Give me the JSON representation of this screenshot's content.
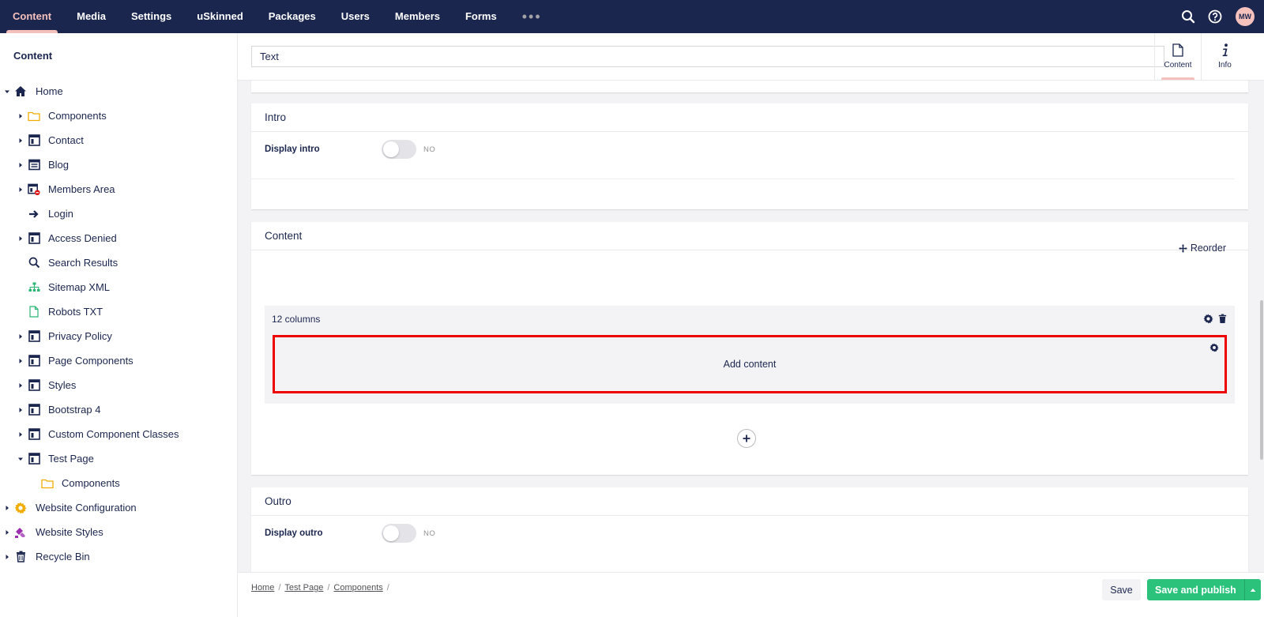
{
  "nav": {
    "sections": [
      "Content",
      "Media",
      "Settings",
      "uSkinned",
      "Packages",
      "Users",
      "Members",
      "Forms"
    ],
    "more": "•••",
    "avatar_initials": "MW",
    "icons": [
      "search-icon",
      "help-icon"
    ]
  },
  "sidebar": {
    "title": "Content",
    "tree": [
      {
        "label": "Home",
        "icon": "home-icon"
      },
      {
        "label": "Components",
        "icon": "folder-icon"
      },
      {
        "label": "Contact",
        "icon": "page-icon"
      },
      {
        "label": "Blog",
        "icon": "blog-icon"
      },
      {
        "label": "Members Area",
        "icon": "protected-page-icon"
      },
      {
        "label": "Login",
        "icon": "arrow-right-icon"
      },
      {
        "label": "Access Denied",
        "icon": "page-icon"
      },
      {
        "label": "Search Results",
        "icon": "search-icon"
      },
      {
        "label": "Sitemap XML",
        "icon": "sitemap-icon"
      },
      {
        "label": "Robots TXT",
        "icon": "document-icon"
      },
      {
        "label": "Privacy Policy",
        "icon": "page-icon"
      },
      {
        "label": "Page Components",
        "icon": "page-icon"
      },
      {
        "label": "Styles",
        "icon": "page-icon"
      },
      {
        "label": "Bootstrap 4",
        "icon": "page-icon"
      },
      {
        "label": "Custom Component Classes",
        "icon": "page-icon"
      },
      {
        "label": "Test Page",
        "icon": "page-icon"
      },
      {
        "label": "Components",
        "icon": "folder-icon"
      },
      {
        "label": "Website Configuration",
        "icon": "gear-icon"
      },
      {
        "label": "Website Styles",
        "icon": "brush-icon"
      },
      {
        "label": "Recycle Bin",
        "icon": "trash-icon"
      }
    ]
  },
  "editor": {
    "name_value": "Text",
    "apps": [
      {
        "label": "Content",
        "icon": "document-icon"
      },
      {
        "label": "Info",
        "icon": "info-icon"
      }
    ],
    "intro": {
      "title": "Intro",
      "prop_label": "Display intro",
      "toggle_state": "NO"
    },
    "content": {
      "title": "Content",
      "reorder_label": "Reorder",
      "row_title": "12 columns",
      "cell_label": "Add content"
    },
    "outro": {
      "title": "Outro",
      "prop_label": "Display outro",
      "toggle_state": "NO"
    }
  },
  "footer": {
    "breadcrumb": [
      "Home",
      "Test Page",
      "Components"
    ],
    "separator": "/",
    "save_label": "Save",
    "publish_label": "Save and publish"
  },
  "colors": {
    "nav_bg": "#1b264f",
    "accent": "#f5c1bc",
    "publish_green": "#2bc37c",
    "highlight_red": "#ee0000",
    "folder_orange": "#f0ac00"
  }
}
